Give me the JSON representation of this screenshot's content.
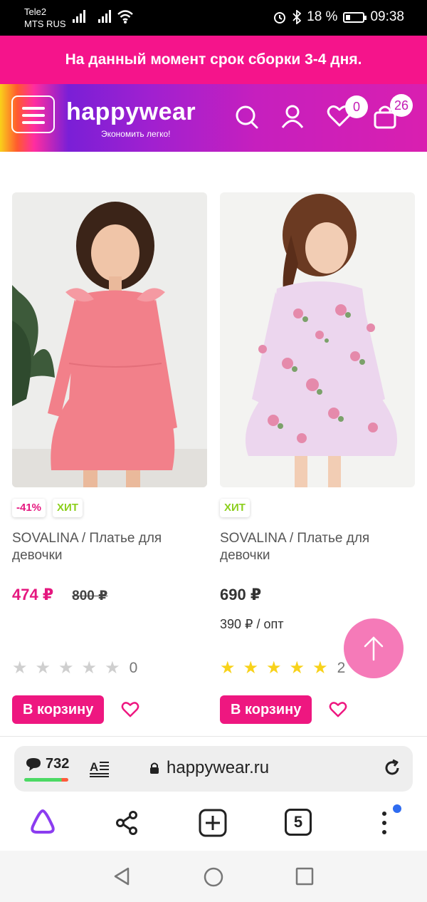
{
  "status_bar": {
    "carrier_1": "Tele2",
    "carrier_2": "MTS RUS",
    "battery": "18 %",
    "time": "09:38"
  },
  "notice": {
    "text": "На данный момент срок сборки 3-4 дня."
  },
  "header": {
    "logo": "happywear",
    "slogan": "Экономить легко!",
    "wishlist_count": "0",
    "cart_count": "26",
    "icons": [
      "menu-icon",
      "search-icon",
      "user-icon",
      "heart-icon",
      "bag-icon"
    ]
  },
  "products": [
    {
      "badges": [
        "-41%",
        "ХИТ"
      ],
      "title": "SOVALINA / Платье для девочки",
      "price": "474 ₽",
      "old_price": "800 ₽",
      "opt_price": "",
      "rating": 0,
      "rating_count": "0",
      "buy_label": "В корзину"
    },
    {
      "badges": [
        "ХИТ"
      ],
      "title": "SOVALINA / Платье для девочки",
      "price": "690 ₽",
      "old_price": "",
      "opt_price": "390 ₽ / опт",
      "rating": 5,
      "rating_count": "2",
      "buy_label": "В корзину"
    }
  ],
  "browser": {
    "comments_count": "732",
    "url": "happywear.ru",
    "tabs_count": "5"
  },
  "colors": {
    "brand_pink": "#f5148b",
    "button_pink": "#ee1780",
    "hit_green": "#8ccf1d",
    "star_yellow": "#f8d21a"
  }
}
